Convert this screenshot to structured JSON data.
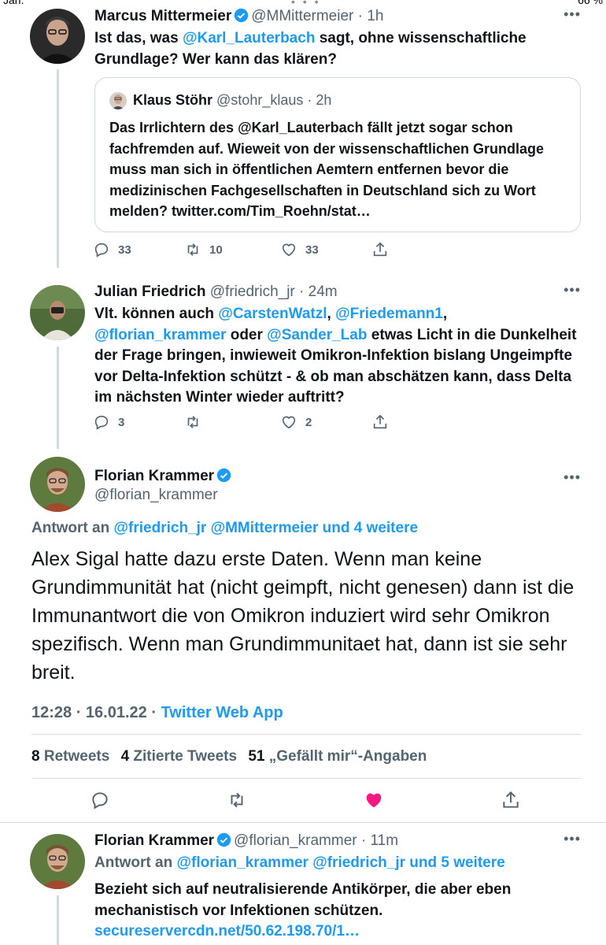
{
  "statusbar": {
    "left": "Jan.",
    "right": "66 %",
    "dots": "• • •"
  },
  "tweet1": {
    "name": "Marcus Mittermeier",
    "handle": "@MMittermeier",
    "time": "1h",
    "text_parts": [
      "Ist das, was ",
      "@Karl_Lauterbach",
      " sagt, ohne wissenschaftliche Grundlage? Wer kann das klären?"
    ],
    "quote": {
      "name": "Klaus Stöhr",
      "handle": "@stohr_klaus",
      "time": "2h",
      "text": "Das Irrlichtern des @Karl_Lauterbach fällt jetzt sogar schon fachfremden auf. Wieweit von der wissenschaftlichen Grundlage muss man sich in öffentlichen Aemtern entfernen bevor die medizinischen Fachgesellschaften in Deutschland sich zu Wort melden? twitter.com/Tim_Roehn/stat…"
    },
    "replies": "33",
    "retweets": "10",
    "likes": "33"
  },
  "tweet2": {
    "name": "Julian Friedrich",
    "handle": "@friedrich_jr",
    "time": "24m",
    "text_parts": [
      "Vlt. können auch ",
      "@CarstenWatzl",
      ", ",
      "@Friedemann1",
      ", ",
      "@florian_krammer",
      " oder ",
      "@Sander_Lab",
      " etwas Licht in die Dunkelheit der Frage bringen, inwieweit Omikron-Infektion bislang Ungeimpfte vor Delta-Infektion schützt - & ob man abschätzen kann, dass Delta im nächsten Winter wieder auftritt?"
    ],
    "replies": "3",
    "retweets": "",
    "likes": "2"
  },
  "focal": {
    "name": "Florian Krammer",
    "handle": "@florian_krammer",
    "reply_prefix": "Antwort an ",
    "reply_links": "@friedrich_jr @MMittermeier und 4 weitere",
    "text": "Alex Sigal hatte dazu erste Daten. Wenn man keine Grundimmunität hat (nicht geimpft, nicht genesen) dann ist die Immunantwort die von Omikron induziert wird sehr Omikron spezifisch. Wenn man Grundimmunitaet hat, dann ist sie sehr breit.",
    "time": "12:28 · 16.01.22 · ",
    "source": "Twitter Web App",
    "retweets_num": "8",
    "retweets_label": "Retweets",
    "quotes_num": "4",
    "quotes_label": "Zitierte Tweets",
    "likes_num": "51",
    "likes_label": "„Gefällt mir“-Angaben",
    "like_color": "#f91880"
  },
  "tweet4": {
    "name": "Florian Krammer",
    "handle": "@florian_krammer",
    "time": "11m",
    "reply_prefix": "Antwort an ",
    "reply_links": "@florian_krammer @friedrich_jr und 5 weitere",
    "text": "Bezieht sich auf neutralisierende Antikörper, die aber eben mechanistisch vor Infektionen schützen. ",
    "link": "secureservercdn.net/50.62.198.70/1…"
  },
  "more_glyph": "•••",
  "colors": {
    "link": "#1d9bf0",
    "muted": "#536471",
    "verified": "#1d9bf0",
    "line": "#cfd9de"
  }
}
